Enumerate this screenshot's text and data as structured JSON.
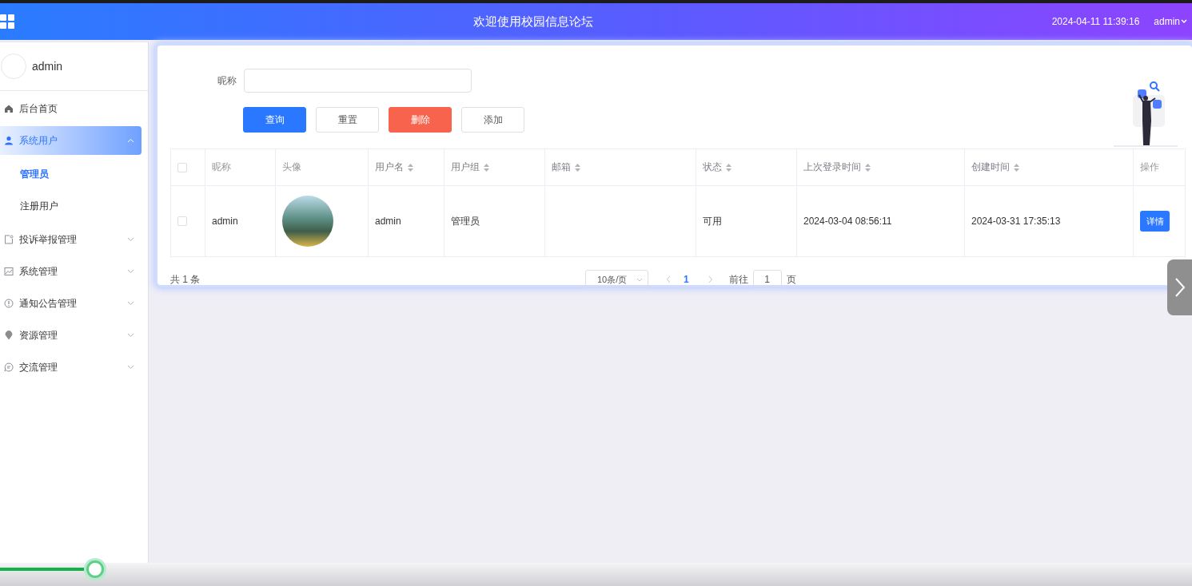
{
  "header": {
    "title": "欢迎使用校园信息论坛",
    "datetime": "2024-04-11 11:39:16",
    "user": "admin"
  },
  "sidebar": {
    "profile": {
      "name": "admin"
    },
    "items": [
      {
        "label": "后台首页",
        "kind": "link",
        "selected": false
      },
      {
        "label": "系统用户",
        "kind": "submenu",
        "expanded": true,
        "selected": true,
        "children": [
          {
            "label": "管理员",
            "selected": true
          },
          {
            "label": "注册用户",
            "selected": false
          }
        ]
      },
      {
        "label": "投诉举报管理",
        "kind": "submenu",
        "expanded": false,
        "selected": false
      },
      {
        "label": "系统管理",
        "kind": "submenu",
        "expanded": false,
        "selected": false
      },
      {
        "label": "通知公告管理",
        "kind": "submenu",
        "expanded": false,
        "selected": false
      },
      {
        "label": "资源管理",
        "kind": "submenu",
        "expanded": false,
        "selected": false
      },
      {
        "label": "交流管理",
        "kind": "submenu",
        "expanded": false,
        "selected": false
      }
    ]
  },
  "search": {
    "label": "昵称"
  },
  "buttons": [
    {
      "label": "查询",
      "kind": "primary"
    },
    {
      "label": "重置",
      "kind": "plain"
    },
    {
      "label": "删除",
      "kind": "danger"
    },
    {
      "label": "添加",
      "kind": "plain"
    }
  ],
  "table": {
    "all_checked": false,
    "columns": [
      {
        "label": "昵称",
        "sortable": false
      },
      {
        "label": "头像",
        "sortable": false
      },
      {
        "label": "用户名",
        "sortable": true
      },
      {
        "label": "用户组",
        "sortable": true
      },
      {
        "label": "邮箱",
        "sortable": true
      },
      {
        "label": "状态",
        "sortable": true
      },
      {
        "label": "上次登录时间",
        "sortable": true
      },
      {
        "label": "创建时间",
        "sortable": true
      },
      {
        "label": "操作",
        "sortable": false
      }
    ],
    "rows": [
      {
        "checked": false,
        "nickname": "admin",
        "username": "admin",
        "group": "管理员",
        "status": "可用",
        "last_login": "2024-03-04 08:56:11",
        "created": "2024-03-31 17:35:13",
        "action": "详情"
      }
    ]
  },
  "pagination": {
    "total": "共 1 条",
    "page_size": "10条/页",
    "pages": [
      {
        "label": "1",
        "selected": true
      }
    ],
    "goto_label": "前往",
    "goto_value": "1",
    "goto_suffix": "页"
  },
  "player": {
    "level": 0.08
  }
}
